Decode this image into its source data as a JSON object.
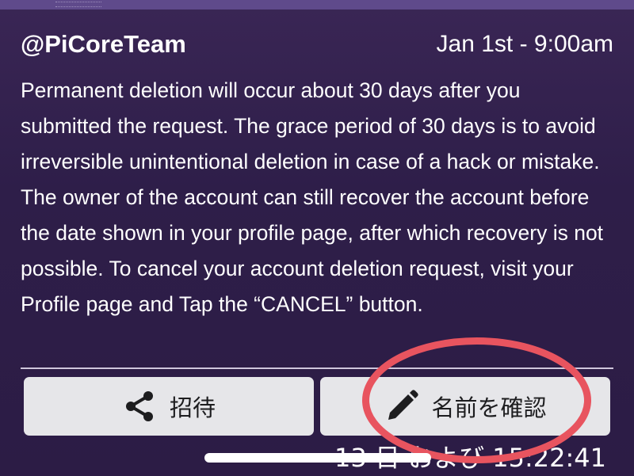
{
  "post": {
    "author": "@PiCoreTeam",
    "timestamp": "Jan 1st - 9:00am",
    "body": "Permanent deletion will occur about 30 days after you submitted the request. The grace period of 30 days is to avoid irreversible unintentional deletion in case of a hack or mistake. The owner of the account can still recover the account before the date shown in your profile page, after which recovery is not possible. To cancel your account deletion request, visit your Profile page and Tap the “CANCEL” button."
  },
  "actions": {
    "invite_label": "招待",
    "confirm_name_label": "名前を確認"
  },
  "footer": {
    "partial_text": "13 日 および 15:22:41"
  },
  "icons": {
    "invite": "share-icon",
    "confirm": "pencil-icon"
  },
  "colors": {
    "background": "#2e1d47",
    "button_bg": "#e6e6e9",
    "highlight": "#e8545f"
  }
}
